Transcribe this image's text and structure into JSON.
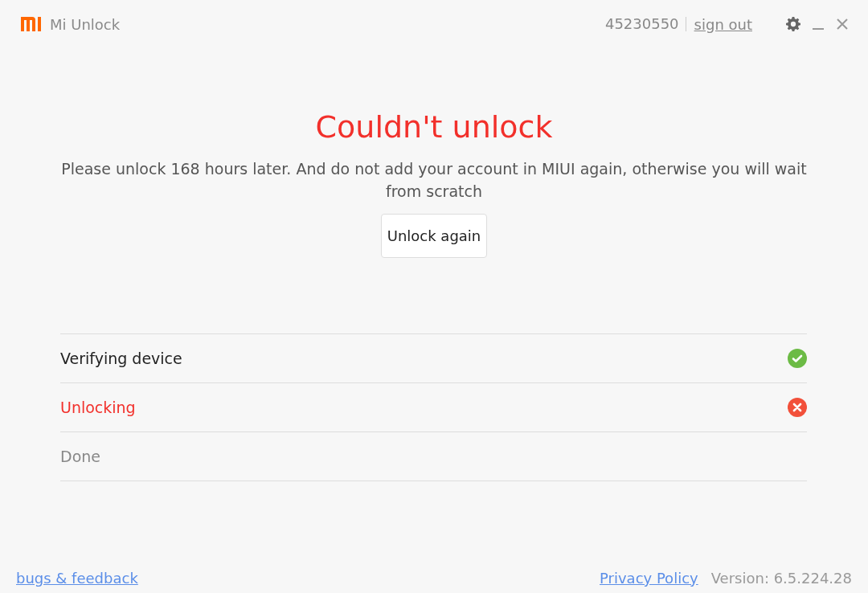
{
  "window": {
    "title": "Mi Unlock",
    "account": "45230550",
    "sign_out": "sign out"
  },
  "result": {
    "title": "Couldn't unlock",
    "message": "Please unlock 168 hours later. And do not add your account in MIUI again, otherwise you will wait from scratch",
    "button": "Unlock again"
  },
  "steps": [
    {
      "label": "Verifying device",
      "kind": "done"
    },
    {
      "label": "Unlocking",
      "kind": "failed"
    },
    {
      "label": "Done",
      "kind": "pending"
    }
  ],
  "footer": {
    "feedback_link": "bugs & feedback",
    "privacy_link": "Privacy Policy",
    "version": "Version: 6.5.224.28"
  }
}
